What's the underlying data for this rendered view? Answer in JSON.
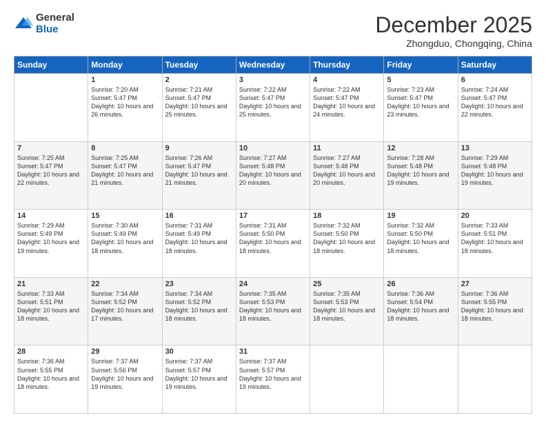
{
  "logo": {
    "general": "General",
    "blue": "Blue"
  },
  "header": {
    "month": "December 2025",
    "location": "Zhongduo, Chongqing, China"
  },
  "weekdays": [
    "Sunday",
    "Monday",
    "Tuesday",
    "Wednesday",
    "Thursday",
    "Friday",
    "Saturday"
  ],
  "weeks": [
    [
      {
        "day": "",
        "sunrise": "",
        "sunset": "",
        "daylight": ""
      },
      {
        "day": "1",
        "sunrise": "Sunrise: 7:20 AM",
        "sunset": "Sunset: 5:47 PM",
        "daylight": "Daylight: 10 hours and 26 minutes."
      },
      {
        "day": "2",
        "sunrise": "Sunrise: 7:21 AM",
        "sunset": "Sunset: 5:47 PM",
        "daylight": "Daylight: 10 hours and 25 minutes."
      },
      {
        "day": "3",
        "sunrise": "Sunrise: 7:22 AM",
        "sunset": "Sunset: 5:47 PM",
        "daylight": "Daylight: 10 hours and 25 minutes."
      },
      {
        "day": "4",
        "sunrise": "Sunrise: 7:22 AM",
        "sunset": "Sunset: 5:47 PM",
        "daylight": "Daylight: 10 hours and 24 minutes."
      },
      {
        "day": "5",
        "sunrise": "Sunrise: 7:23 AM",
        "sunset": "Sunset: 5:47 PM",
        "daylight": "Daylight: 10 hours and 23 minutes."
      },
      {
        "day": "6",
        "sunrise": "Sunrise: 7:24 AM",
        "sunset": "Sunset: 5:47 PM",
        "daylight": "Daylight: 10 hours and 22 minutes."
      }
    ],
    [
      {
        "day": "7",
        "sunrise": "Sunrise: 7:25 AM",
        "sunset": "Sunset: 5:47 PM",
        "daylight": "Daylight: 10 hours and 22 minutes."
      },
      {
        "day": "8",
        "sunrise": "Sunrise: 7:25 AM",
        "sunset": "Sunset: 5:47 PM",
        "daylight": "Daylight: 10 hours and 21 minutes."
      },
      {
        "day": "9",
        "sunrise": "Sunrise: 7:26 AM",
        "sunset": "Sunset: 5:47 PM",
        "daylight": "Daylight: 10 hours and 21 minutes."
      },
      {
        "day": "10",
        "sunrise": "Sunrise: 7:27 AM",
        "sunset": "Sunset: 5:48 PM",
        "daylight": "Daylight: 10 hours and 20 minutes."
      },
      {
        "day": "11",
        "sunrise": "Sunrise: 7:27 AM",
        "sunset": "Sunset: 5:48 PM",
        "daylight": "Daylight: 10 hours and 20 minutes."
      },
      {
        "day": "12",
        "sunrise": "Sunrise: 7:28 AM",
        "sunset": "Sunset: 5:48 PM",
        "daylight": "Daylight: 10 hours and 19 minutes."
      },
      {
        "day": "13",
        "sunrise": "Sunrise: 7:29 AM",
        "sunset": "Sunset: 5:48 PM",
        "daylight": "Daylight: 10 hours and 19 minutes."
      }
    ],
    [
      {
        "day": "14",
        "sunrise": "Sunrise: 7:29 AM",
        "sunset": "Sunset: 5:49 PM",
        "daylight": "Daylight: 10 hours and 19 minutes."
      },
      {
        "day": "15",
        "sunrise": "Sunrise: 7:30 AM",
        "sunset": "Sunset: 5:49 PM",
        "daylight": "Daylight: 10 hours and 18 minutes."
      },
      {
        "day": "16",
        "sunrise": "Sunrise: 7:31 AM",
        "sunset": "Sunset: 5:49 PM",
        "daylight": "Daylight: 10 hours and 18 minutes."
      },
      {
        "day": "17",
        "sunrise": "Sunrise: 7:31 AM",
        "sunset": "Sunset: 5:50 PM",
        "daylight": "Daylight: 10 hours and 18 minutes."
      },
      {
        "day": "18",
        "sunrise": "Sunrise: 7:32 AM",
        "sunset": "Sunset: 5:50 PM",
        "daylight": "Daylight: 10 hours and 18 minutes."
      },
      {
        "day": "19",
        "sunrise": "Sunrise: 7:32 AM",
        "sunset": "Sunset: 5:50 PM",
        "daylight": "Daylight: 10 hours and 18 minutes."
      },
      {
        "day": "20",
        "sunrise": "Sunrise: 7:33 AM",
        "sunset": "Sunset: 5:51 PM",
        "daylight": "Daylight: 10 hours and 18 minutes."
      }
    ],
    [
      {
        "day": "21",
        "sunrise": "Sunrise: 7:33 AM",
        "sunset": "Sunset: 5:51 PM",
        "daylight": "Daylight: 10 hours and 18 minutes."
      },
      {
        "day": "22",
        "sunrise": "Sunrise: 7:34 AM",
        "sunset": "Sunset: 5:52 PM",
        "daylight": "Daylight: 10 hours and 17 minutes."
      },
      {
        "day": "23",
        "sunrise": "Sunrise: 7:34 AM",
        "sunset": "Sunset: 5:52 PM",
        "daylight": "Daylight: 10 hours and 18 minutes."
      },
      {
        "day": "24",
        "sunrise": "Sunrise: 7:35 AM",
        "sunset": "Sunset: 5:53 PM",
        "daylight": "Daylight: 10 hours and 18 minutes."
      },
      {
        "day": "25",
        "sunrise": "Sunrise: 7:35 AM",
        "sunset": "Sunset: 5:53 PM",
        "daylight": "Daylight: 10 hours and 18 minutes."
      },
      {
        "day": "26",
        "sunrise": "Sunrise: 7:36 AM",
        "sunset": "Sunset: 5:54 PM",
        "daylight": "Daylight: 10 hours and 18 minutes."
      },
      {
        "day": "27",
        "sunrise": "Sunrise: 7:36 AM",
        "sunset": "Sunset: 5:55 PM",
        "daylight": "Daylight: 10 hours and 18 minutes."
      }
    ],
    [
      {
        "day": "28",
        "sunrise": "Sunrise: 7:36 AM",
        "sunset": "Sunset: 5:55 PM",
        "daylight": "Daylight: 10 hours and 18 minutes."
      },
      {
        "day": "29",
        "sunrise": "Sunrise: 7:37 AM",
        "sunset": "Sunset: 5:56 PM",
        "daylight": "Daylight: 10 hours and 19 minutes."
      },
      {
        "day": "30",
        "sunrise": "Sunrise: 7:37 AM",
        "sunset": "Sunset: 5:57 PM",
        "daylight": "Daylight: 10 hours and 19 minutes."
      },
      {
        "day": "31",
        "sunrise": "Sunrise: 7:37 AM",
        "sunset": "Sunset: 5:57 PM",
        "daylight": "Daylight: 10 hours and 19 minutes."
      },
      {
        "day": "",
        "sunrise": "",
        "sunset": "",
        "daylight": ""
      },
      {
        "day": "",
        "sunrise": "",
        "sunset": "",
        "daylight": ""
      },
      {
        "day": "",
        "sunrise": "",
        "sunset": "",
        "daylight": ""
      }
    ]
  ]
}
